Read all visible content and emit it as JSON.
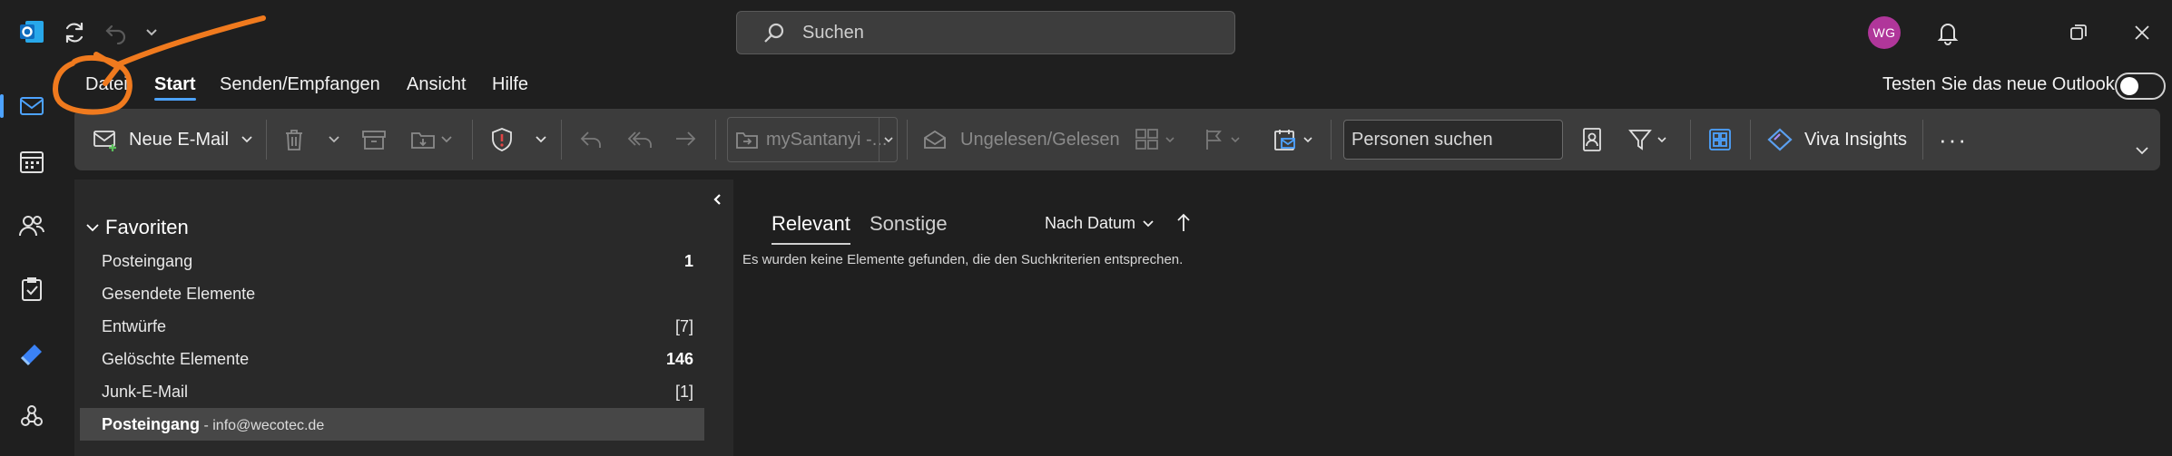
{
  "colors": {
    "accent": "#4da3ff",
    "avatar_bg": "#b0369a",
    "annotation": "#f07a1e"
  },
  "titlebar": {
    "app_icon": "outlook-logo-icon",
    "sync_icon": "sync-icon",
    "undo_icon": "undo-icon",
    "search_placeholder": "Suchen",
    "avatar_initials": "WG",
    "bell_icon": "bell-icon",
    "restore_icon": "restore-icon",
    "close_icon": "close-icon"
  },
  "rail": {
    "items": [
      {
        "name": "mail-icon"
      },
      {
        "name": "calendar-icon"
      },
      {
        "name": "people-icon"
      },
      {
        "name": "tasks-icon"
      },
      {
        "name": "todo-icon"
      },
      {
        "name": "apps-icon"
      }
    ]
  },
  "menu": {
    "tabs": [
      {
        "label": "Datei"
      },
      {
        "label": "Start",
        "active": true
      },
      {
        "label": "Senden/Empfangen"
      },
      {
        "label": "Ansicht"
      },
      {
        "label": "Hilfe"
      }
    ],
    "new_outlook_label": "Testen Sie das neue Outlook",
    "new_outlook_toggle": false
  },
  "ribbon": {
    "new_mail_label": "Neue E-Mail",
    "move_target": "mySantanyi -...",
    "read_unread_label": "Ungelesen/Gelesen",
    "people_search_placeholder": "Personen suchen",
    "viva_label": "Viva Insights",
    "more_label": "···"
  },
  "folders": {
    "favorites_label": "Favoriten",
    "items": [
      {
        "name": "Posteingang",
        "count": "1",
        "bold_count": true
      },
      {
        "name": "Gesendete Elemente",
        "count": ""
      },
      {
        "name": "Entwürfe",
        "count": "[7]"
      },
      {
        "name": "Gelöschte Elemente",
        "count": "146",
        "bold_count": true
      },
      {
        "name": "Junk-E-Mail",
        "count": "[1]"
      }
    ],
    "account_folder": {
      "name": "Posteingang",
      "account": " - info@wecotec.de"
    }
  },
  "messages": {
    "tabs": [
      {
        "label": "Relevant",
        "active": true
      },
      {
        "label": "Sonstige"
      }
    ],
    "sort_label": "Nach Datum",
    "empty_text": "Es wurden keine Elemente gefunden, die den Suchkriterien entsprechen."
  }
}
